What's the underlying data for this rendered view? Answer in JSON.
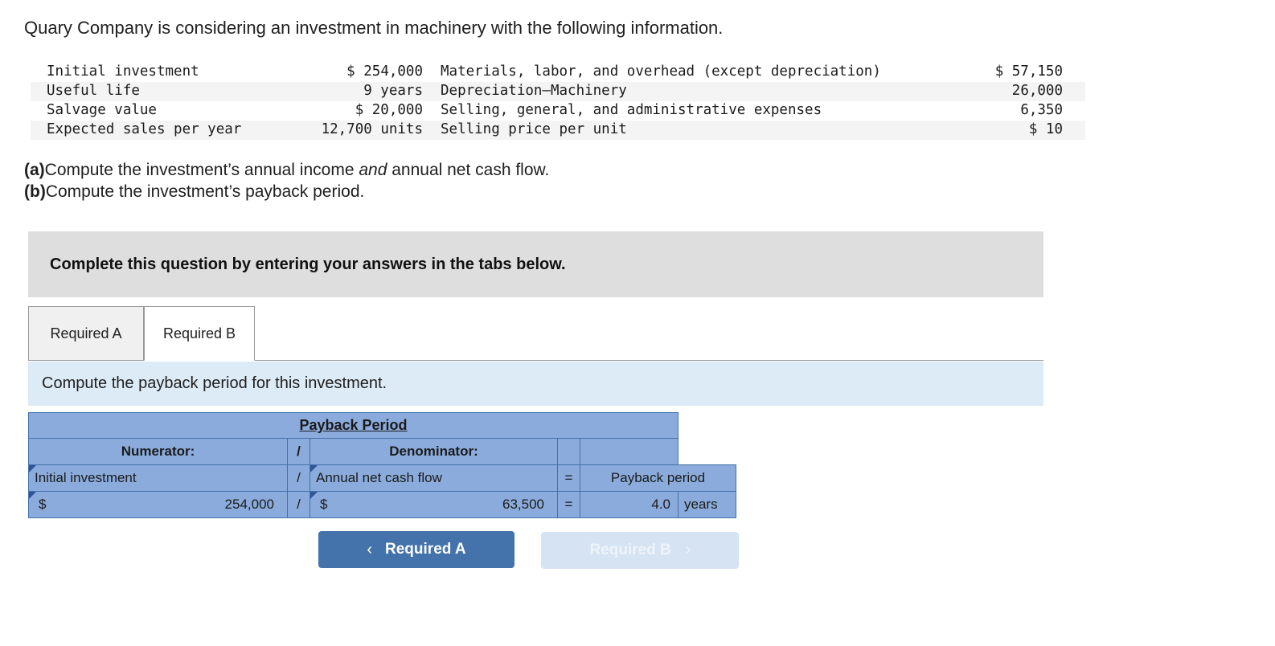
{
  "intro": "Quary Company is considering an investment in machinery with the following information.",
  "facts": {
    "rows": [
      {
        "label": "Initial investment",
        "value": "$ 254,000",
        "label2": "Materials, labor, and overhead (except depreciation)",
        "value2": "$ 57,150"
      },
      {
        "label": "Useful life",
        "value": "9 years",
        "label2": "Depreciation—Machinery",
        "value2": "26,000"
      },
      {
        "label": "Salvage value",
        "value": "$ 20,000",
        "label2": "Selling, general, and administrative expenses",
        "value2": "6,350"
      },
      {
        "label": "Expected sales per year",
        "value": "12,700 units",
        "label2": "Selling price per unit",
        "value2": "$ 10"
      }
    ]
  },
  "requirements": {
    "a_tag": "(a)",
    "a_text_1": "Compute the investment’s annual income ",
    "a_emph": "and",
    "a_text_2": " annual net cash flow.",
    "b_tag": "(b)",
    "b_text": "Compute the investment’s payback period."
  },
  "banner": {
    "text": "Complete this question by entering your answers in the tabs below."
  },
  "tabs": [
    {
      "label": "Required A",
      "active": false
    },
    {
      "label": "Required B",
      "active": true
    }
  ],
  "instruction": {
    "text": "Compute the payback period for this investment."
  },
  "sheet": {
    "title": "Payback Period",
    "header": {
      "numerator": "Numerator:",
      "slash": "/",
      "denominator": "Denominator:"
    },
    "label_row": {
      "numerator": "Initial investment",
      "slash": "/",
      "denominator": "Annual net cash flow",
      "equals": "=",
      "result": "Payback period"
    },
    "value_row": {
      "numerator_symbol": "$",
      "numerator_value": "254,000",
      "slash": "/",
      "denominator_symbol": "$",
      "denominator_value": "63,500",
      "equals": "=",
      "result_value": "4.0",
      "result_unit": "years"
    }
  },
  "nav": {
    "prev_chevron": "‹",
    "prev_label": "Required A",
    "next_label": "Required B",
    "next_chevron": "›"
  },
  "colors": {
    "sheet_header": "#8aabdb",
    "sheet_border": "#4472a8",
    "result_highlight": "#fdf7b8",
    "banner_gray": "#dedede",
    "instruction_blue": "#ddebf7",
    "button_active": "#4472ab",
    "button_disabled": "#d6e3f2"
  }
}
